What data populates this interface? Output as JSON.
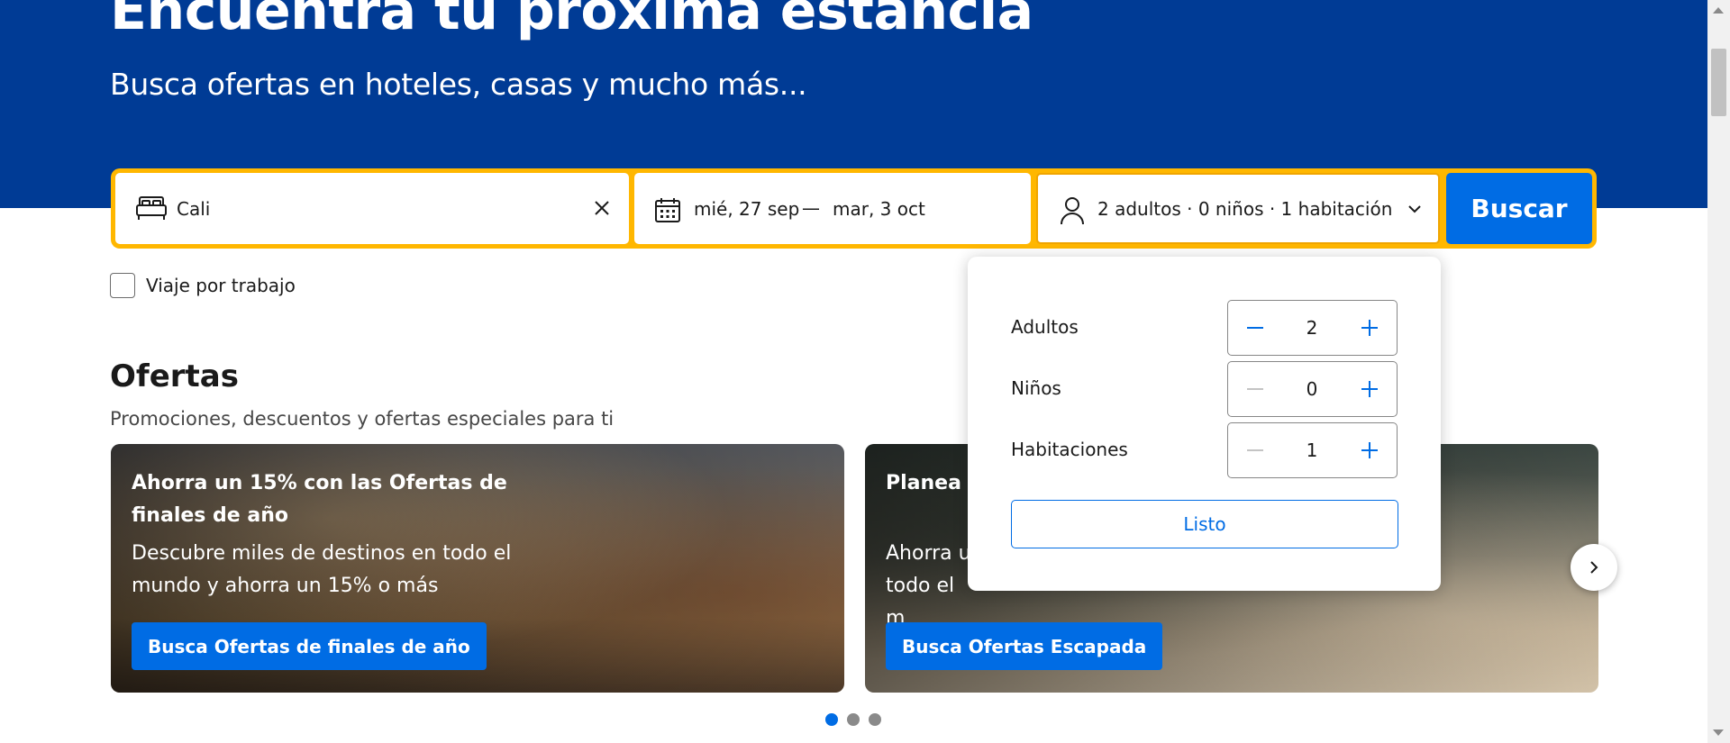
{
  "hero": {
    "title": "Encuentra tu próxima estancia",
    "subtitle": "Busca ofertas en hoteles, casas y mucho más..."
  },
  "search": {
    "destination_value": "Cali",
    "destination_icon": "bed-icon",
    "clear_icon": "close-icon",
    "date_icon": "calendar-icon",
    "checkin": "mié, 27 sep",
    "date_separator": "—",
    "checkout": "mar, 3 oct",
    "occupancy_icon": "person-icon",
    "occupancy": "2 adultos · 0 niños · 1 habitación",
    "chevron_icon": "chevron-down-icon",
    "button_label": "Buscar"
  },
  "work_trip": {
    "label": "Viaje por trabajo",
    "checked": false
  },
  "offers": {
    "title": "Ofertas",
    "subtitle": "Promociones, descuentos y ofertas especiales para ti",
    "cards": [
      {
        "title": "Ahorra un 15% con las Ofertas de finales de año",
        "description": "Descubre miles de destinos en todo el mundo y ahorra un 15% o más",
        "button": "Busca Ofertas de finales de año"
      },
      {
        "title": "Planea u",
        "description": "Ahorra u todo el m aventuras",
        "button": "Busca Ofertas Escapada"
      }
    ],
    "next_icon": "chevron-right-icon",
    "carousel_dots": 3,
    "active_dot": 0
  },
  "occupancy_popover": {
    "rows": [
      {
        "label": "Adultos",
        "value": "2"
      },
      {
        "label": "Niños",
        "value": "0"
      },
      {
        "label": "Habitaciones",
        "value": "1"
      }
    ],
    "done_label": "Listo"
  },
  "colors": {
    "brand_blue": "#003b95",
    "action_blue": "#006ce4",
    "search_border": "#ffb700"
  }
}
